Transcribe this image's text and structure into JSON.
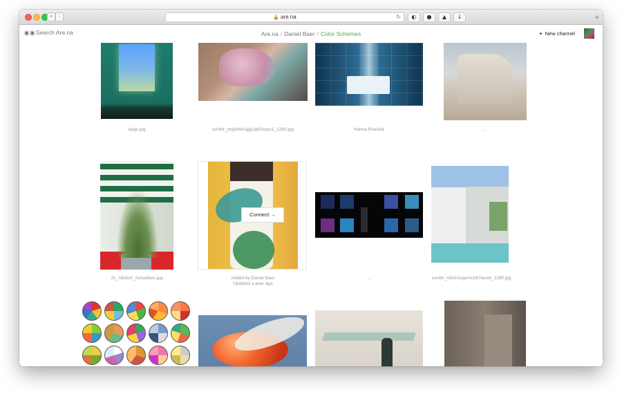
{
  "browser": {
    "url": "are.na",
    "back_glyph": "‹",
    "forward_glyph": "›",
    "lock_glyph": "🔒",
    "reload_glyph": "↻",
    "toolbar_glyphs": [
      "◐",
      "●",
      "▲",
      "↓"
    ],
    "newtab_glyph": "+"
  },
  "header": {
    "logo": "✳✳",
    "search_placeholder": "Search Are.na",
    "breadcrumb": {
      "site": "Are.na",
      "separator": "/",
      "user": "Daniel Baer",
      "channel": "Color Schemes"
    },
    "new_channel_plus": "+",
    "new_channel_label": "New channel"
  },
  "colors": {
    "channel_accent": "#4bad4b"
  },
  "blocks": [
    {
      "caption": "large.jpg"
    },
    {
      "caption": "tumblr_nbyk9wUggj1qb5hqzo1_1280.jpg"
    },
    {
      "caption": "Hanna Roeckle"
    },
    {
      "caption": "..."
    },
    {
      "caption": "31_Albdorf_Actualities.jpg"
    },
    {
      "caption": "Added by Daniel Baer",
      "subcaption": "Updated a year ago",
      "hover_action": "Connect →"
    },
    {
      "caption": "..."
    },
    {
      "caption": "tumblr_n9e1msjyme1t87wvo4_1280.jpg"
    }
  ]
}
